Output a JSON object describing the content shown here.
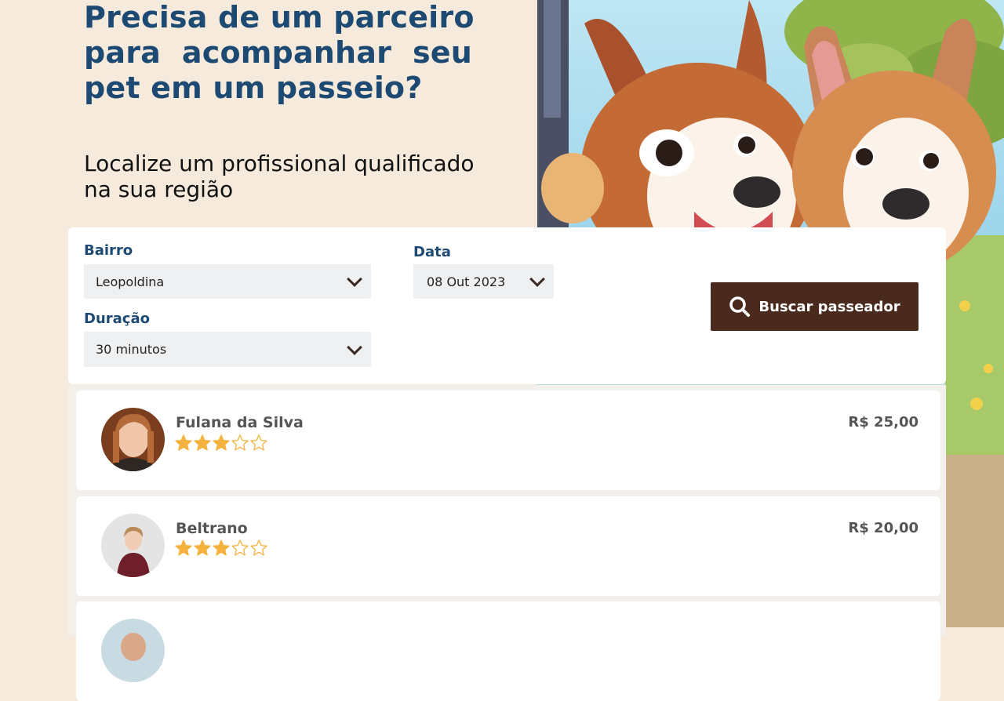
{
  "hero": {
    "title_lines": [
      "Precisa de um parceiro",
      "para  acompanhar  seu",
      "pet em um passeio?"
    ],
    "subtitle_lines": [
      "Localize um profissional qualificado",
      "na sua região"
    ]
  },
  "search": {
    "neighborhood": {
      "label": "Bairro",
      "value": "Leopoldina"
    },
    "duration": {
      "label": "Duração",
      "value": "30 minutos"
    },
    "date": {
      "label": "Data",
      "value": "08 Out 2023"
    },
    "submit_label": "Buscar passeador",
    "accent_color": "#4a2a1d"
  },
  "results": [
    {
      "name": "Fulana da Silva",
      "price": "R$ 25,00",
      "rating": 3,
      "max_rating": 5
    },
    {
      "name": "Beltrano",
      "price": "R$ 20,00",
      "rating": 3,
      "max_rating": 5
    },
    {
      "name": "",
      "price": "",
      "rating": 0,
      "max_rating": 5
    }
  ],
  "colors": {
    "page_bg": "#f6eadc",
    "heading": "#1d4a72",
    "star": "#f4b23e"
  },
  "icons": {
    "search_button": "search-icon",
    "select_arrow": "chevron-down-icon",
    "rating": "star-icon"
  }
}
